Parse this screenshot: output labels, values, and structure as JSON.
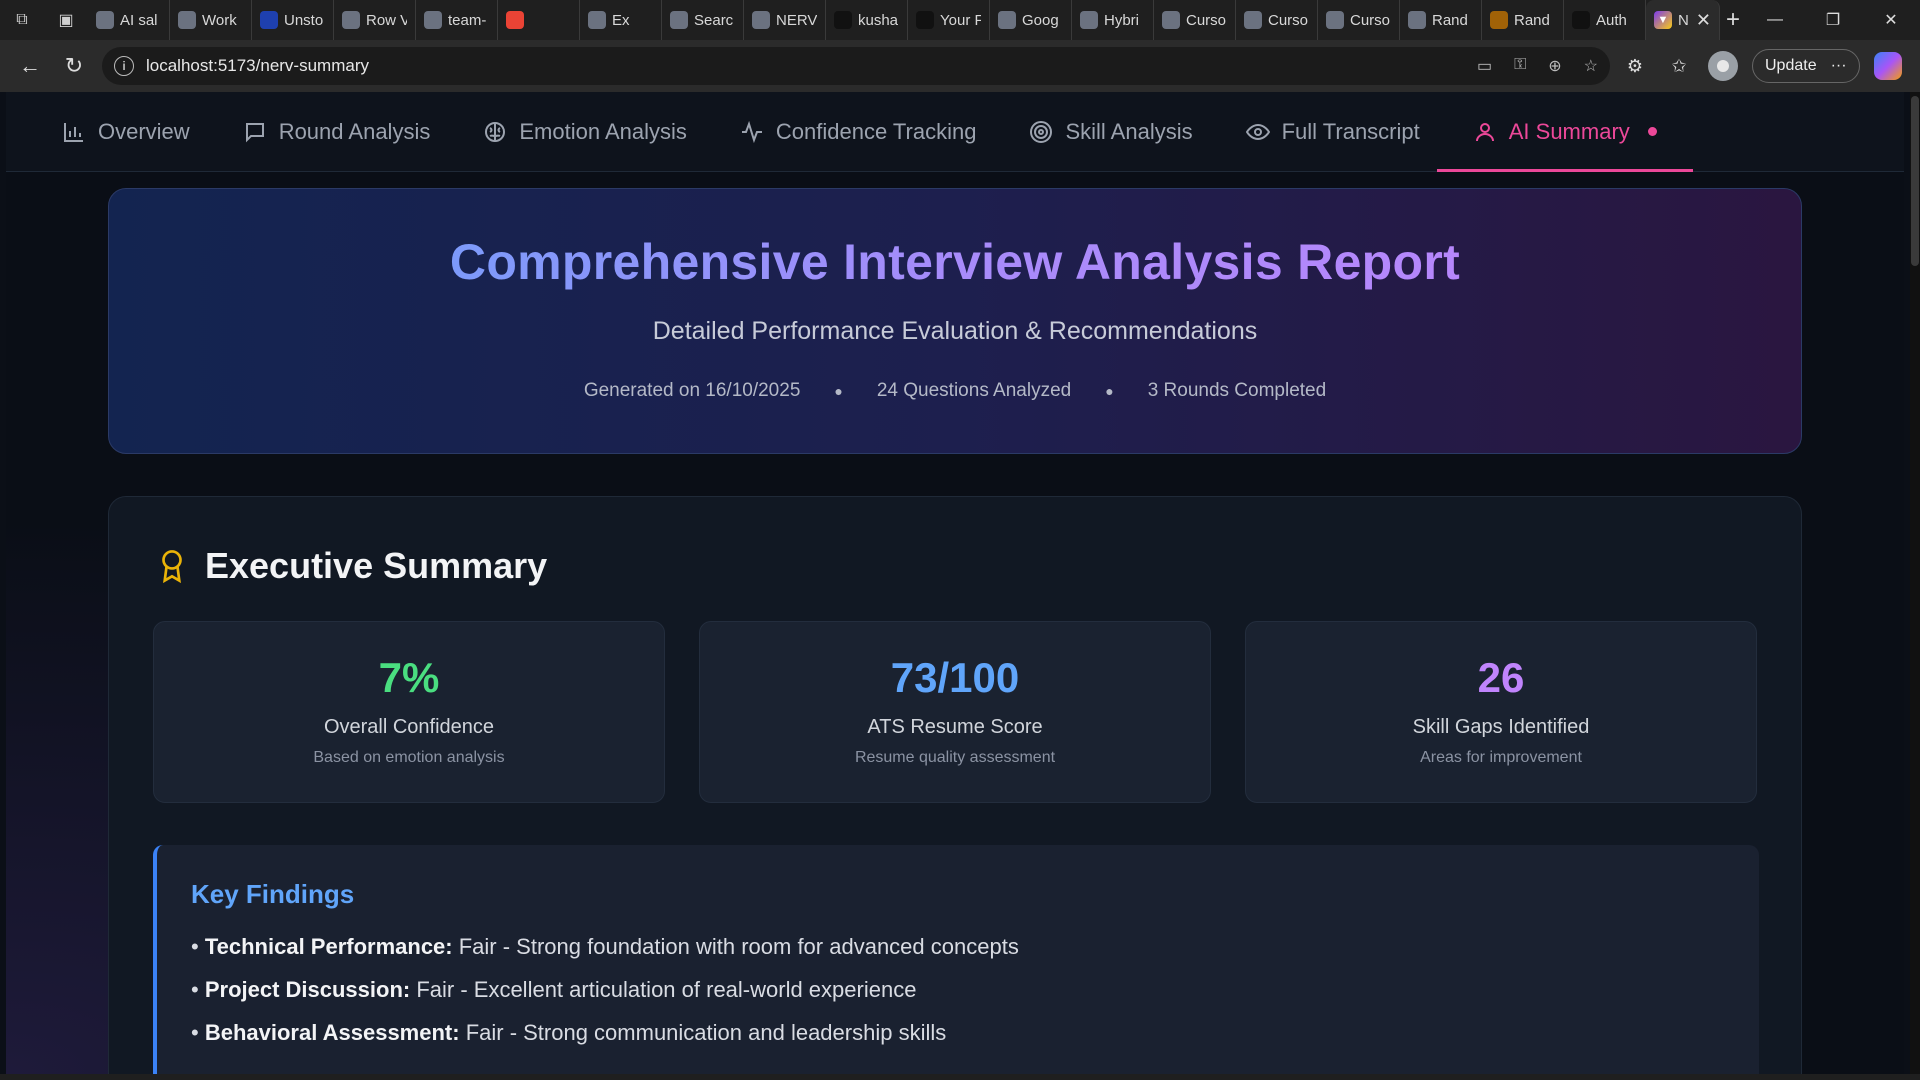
{
  "browser": {
    "tabs": [
      {
        "label": "AI sal",
        "icon": "ai-icon",
        "color": "#6b7280"
      },
      {
        "label": "Work",
        "icon": "workspace-icon",
        "color": "#6b7280"
      },
      {
        "label": "Unsto",
        "icon": "unstop-icon",
        "color": "#1e40af"
      },
      {
        "label": "Row V",
        "icon": "row-icon",
        "color": "#6b7280"
      },
      {
        "label": "team-",
        "icon": "team-icon",
        "color": "#6b7280"
      },
      {
        "label": "",
        "icon": "gmail-icon",
        "color": "#ea4335"
      },
      {
        "label": "Ex",
        "icon": "excalidraw-icon",
        "color": "#6b7280"
      },
      {
        "label": "Searc",
        "icon": "search-tab-icon",
        "color": "#6b7280"
      },
      {
        "label": "NERV",
        "icon": "globe-icon",
        "color": "#6b7280"
      },
      {
        "label": "kusha",
        "icon": "github-icon",
        "color": "#111111"
      },
      {
        "label": "Your F",
        "icon": "github-icon",
        "color": "#111111"
      },
      {
        "label": "Goog",
        "icon": "external-icon",
        "color": "#6b7280"
      },
      {
        "label": "Hybri",
        "icon": "hybrid-icon",
        "color": "#6b7280"
      },
      {
        "label": "Curso",
        "icon": "cursor-icon",
        "color": "#6b7280"
      },
      {
        "label": "Curso",
        "icon": "cursor-icon",
        "color": "#6b7280"
      },
      {
        "label": "Curso",
        "icon": "cursor-icon",
        "color": "#6b7280"
      },
      {
        "label": "Rand",
        "icon": "gear-icon",
        "color": "#6b7280"
      },
      {
        "label": "Rand",
        "icon": "avatar-icon",
        "color": "#a16207"
      },
      {
        "label": "Auth",
        "icon": "auth-icon",
        "color": "#111111"
      }
    ],
    "active_tab": {
      "label": "N",
      "icon": "vite-icon"
    },
    "url": "localhost:5173/nerv-summary",
    "update_label": "Update"
  },
  "nav": {
    "items": [
      {
        "label": "Overview",
        "icon": "bar-chart-icon"
      },
      {
        "label": "Round Analysis",
        "icon": "chat-icon"
      },
      {
        "label": "Emotion Analysis",
        "icon": "brain-icon"
      },
      {
        "label": "Confidence Tracking",
        "icon": "activity-icon"
      },
      {
        "label": "Skill Analysis",
        "icon": "target-icon"
      },
      {
        "label": "Full Transcript",
        "icon": "eye-icon"
      },
      {
        "label": "AI Summary",
        "icon": "user-icon"
      }
    ],
    "active": "AI Summary"
  },
  "hero": {
    "title": "Comprehensive Interview Analysis Report",
    "subtitle": "Detailed Performance Evaluation & Recommendations",
    "generated": "Generated on 16/10/2025",
    "questions": "24 Questions Analyzed",
    "rounds": "3 Rounds Completed"
  },
  "summary": {
    "title": "Executive Summary",
    "icon": "award-icon",
    "stats": [
      {
        "value": "7%",
        "label": "Overall Confidence",
        "sub": "Based on emotion analysis",
        "color": "#4ade80"
      },
      {
        "value": "73/100",
        "label": "ATS Resume Score",
        "sub": "Resume quality assessment",
        "color": "#60a5fa"
      },
      {
        "value": "26",
        "label": "Skill Gaps Identified",
        "sub": "Areas for improvement",
        "color": "#c084fc"
      }
    ],
    "findings": {
      "title": "Key Findings",
      "items": [
        {
          "head": "Technical Performance:",
          "text": " Fair - Strong foundation with room for advanced concepts"
        },
        {
          "head": "Project Discussion:",
          "text": " Fair - Excellent articulation of real-world experience"
        },
        {
          "head": "Behavioral Assessment:",
          "text": " Fair - Strong communication and leadership skills"
        }
      ]
    }
  }
}
